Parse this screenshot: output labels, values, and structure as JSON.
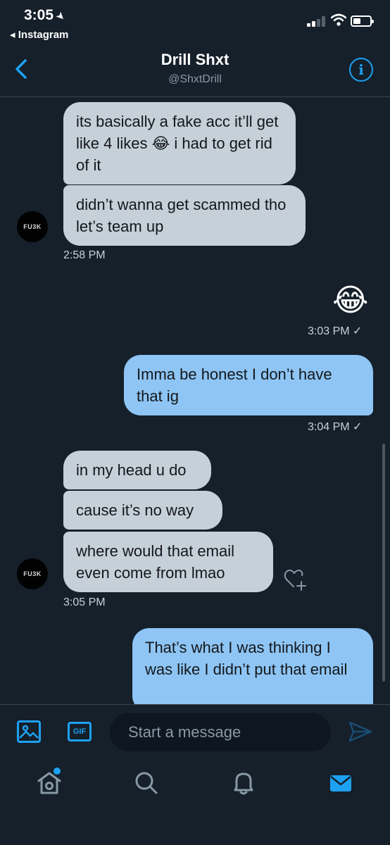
{
  "status_bar": {
    "time": "3:05",
    "back_app": "◂ Instagram"
  },
  "header": {
    "title": "Drill Shxt",
    "handle": "@ShxtDrill"
  },
  "avatar_text": "FU3K",
  "messages": [
    {
      "text": "its basically a fake acc it’ll get like 4 likes 😂 i had to get rid of it"
    },
    {
      "text": "didn’t wanna get scammed tho let’s team up"
    },
    {
      "text": "😂"
    },
    {
      "text": "Imma be honest I don’t have that ig"
    },
    {
      "text": "in my head u do"
    },
    {
      "text": "cause it’s no way"
    },
    {
      "text": "where would that email even come from lmao"
    },
    {
      "text": "That’s what I was thinking I was like I didn’t put that email"
    }
  ],
  "timestamps": {
    "t1": "2:58 PM",
    "t2": "3:03 PM ✓",
    "t3": "3:04 PM ✓",
    "t4": "3:05 PM"
  },
  "composer": {
    "placeholder": "Start a message",
    "gif_label": "GIF"
  },
  "colors": {
    "background": "#15202b",
    "accent": "#1da1f2",
    "received_bubble": "#c5d0d9",
    "sent_bubble": "#8ec5f4"
  },
  "icons": [
    "back-chevron-icon",
    "info-icon",
    "image-icon",
    "gif-icon",
    "send-icon",
    "heart-plus-icon",
    "home-icon",
    "search-icon",
    "bell-icon",
    "mail-icon"
  ]
}
